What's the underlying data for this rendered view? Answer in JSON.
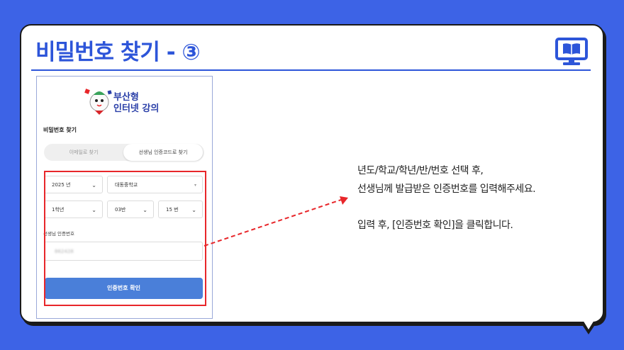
{
  "slide": {
    "title": "비밀번호 찾기 - ③",
    "icon": "book-monitor-icon",
    "accent_color": "#2d55d9",
    "background_color": "#3d63e6",
    "highlight_color": "#e8262a"
  },
  "phone": {
    "logo_line1": "부산형",
    "logo_line2": "인터넷 강의",
    "page_title": "비밀번호 찾기",
    "tabs": [
      {
        "label": "이메일로 찾기",
        "selected": false
      },
      {
        "label": "선생님 인증코드로 찾기",
        "selected": true
      }
    ],
    "year_select": "2025 년",
    "school_select": "대동중학교",
    "grade_select": "1학년",
    "class_select": "03반",
    "number_select": "15 번",
    "code_label": "선생님 인증번호",
    "code_value": "862428",
    "confirm_button": "인증번호 확인",
    "confirm_color": "#4a7fd9"
  },
  "instructions": {
    "line1": "년도/학교/학년/반/번호 선택 후,",
    "line2": "선생님께 발급받은 인증번호를 입력해주세요.",
    "line3": "입력 후, [인증번호 확인]을 클릭합니다."
  }
}
